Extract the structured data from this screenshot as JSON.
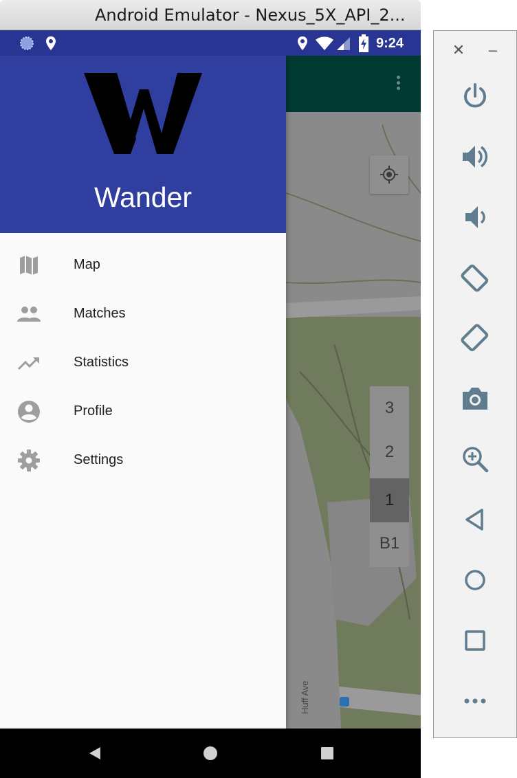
{
  "window": {
    "title": "Android Emulator - Nexus_5X_API_2..."
  },
  "status_bar": {
    "time": "9:24",
    "icons": [
      "loading-icon",
      "location-pin-icon",
      "wifi-icon",
      "signal-icon",
      "battery-charging-icon"
    ]
  },
  "drawer": {
    "app_name": "Wander",
    "logo": "wander-w-logo",
    "items": [
      {
        "label": "Map",
        "icon": "map-icon"
      },
      {
        "label": "Matches",
        "icon": "people-icon"
      },
      {
        "label": "Statistics",
        "icon": "trending-up-icon"
      },
      {
        "label": "Profile",
        "icon": "account-circle-icon"
      },
      {
        "label": "Settings",
        "icon": "gear-icon"
      }
    ]
  },
  "map": {
    "floors": [
      "3",
      "2",
      "1",
      "B1"
    ],
    "active_floor": "1",
    "street_label": "Huff Ave"
  },
  "nav_bar": {
    "buttons": [
      "back-icon",
      "home-icon",
      "recents-icon"
    ]
  },
  "side_panel": {
    "buttons": [
      "power-icon",
      "volume-up-icon",
      "volume-down-icon",
      "rotate-left-icon",
      "rotate-right-icon",
      "camera-icon",
      "zoom-icon",
      "back-icon",
      "home-icon",
      "overview-icon",
      "more-icon"
    ]
  },
  "colors": {
    "drawer_header": "#303f9f",
    "status_bar": "#283593",
    "toolbar": "#003a33",
    "icon_grey": "#9e9e9e",
    "panel_icon": "#5f7d8e"
  }
}
